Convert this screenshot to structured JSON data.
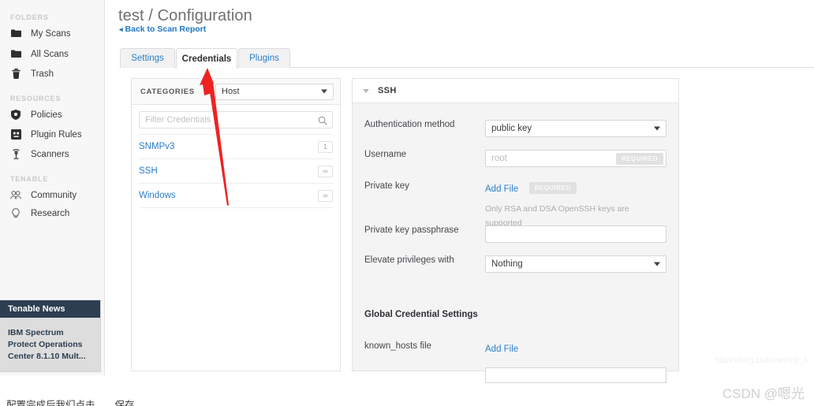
{
  "sidebar": {
    "sections": [
      {
        "label": "FOLDERS"
      },
      {
        "label": "RESOURCES"
      },
      {
        "label": "TENABLE"
      }
    ],
    "folders": [
      {
        "label": "My Scans",
        "icon": "folder-icon"
      },
      {
        "label": "All Scans",
        "icon": "folder-icon"
      },
      {
        "label": "Trash",
        "icon": "trash-icon"
      }
    ],
    "resources": [
      {
        "label": "Policies",
        "icon": "shield-icon"
      },
      {
        "label": "Plugin Rules",
        "icon": "plugin-icon"
      },
      {
        "label": "Scanners",
        "icon": "scanner-icon"
      }
    ],
    "tenable": [
      {
        "label": "Community",
        "icon": "people-icon"
      },
      {
        "label": "Research",
        "icon": "lightbulb-icon"
      }
    ],
    "news": {
      "title": "Tenable News",
      "body": "IBM Spectrum Protect Operations Center 8.1.10 Mult..."
    }
  },
  "header": {
    "title": "test / Configuration",
    "back_link": "Back to Scan Report",
    "back_caret": "◂"
  },
  "tabs": [
    {
      "label": "Settings",
      "active": false
    },
    {
      "label": "Credentials",
      "active": true
    },
    {
      "label": "Plugins",
      "active": false
    }
  ],
  "credentials_panel": {
    "categories_label": "CATEGORIES",
    "category_selected": "Host",
    "filter_placeholder": "Filter Credentials",
    "filter_value": "",
    "rows": [
      {
        "name": "SNMPv3",
        "badge": "1"
      },
      {
        "name": "SSH",
        "badge": "∞"
      },
      {
        "name": "Windows",
        "badge": "∞"
      }
    ]
  },
  "ssh_panel": {
    "title": "SSH",
    "fields": [
      {
        "label": "Authentication method",
        "type": "select",
        "value": "public key"
      },
      {
        "label": "Username",
        "type": "input",
        "value": "",
        "placeholder": "root",
        "required_badge": "REQUIRED"
      },
      {
        "label": "Private key",
        "type": "file",
        "link": "Add File",
        "required_badge": "REQUIRED",
        "hint": "Only RSA and DSA OpenSSH keys are supported"
      },
      {
        "label": "Private key passphrase",
        "type": "input",
        "value": "",
        "placeholder": ""
      },
      {
        "label": "Elevate privileges with",
        "type": "select",
        "value": "Nothing"
      }
    ],
    "global_section": "Global Credential Settings",
    "known_hosts": {
      "label": "known_hosts file",
      "link": "Add File"
    }
  },
  "watermarks": {
    "url": "https://blog.csdn.net/m0_4",
    "csdn": "CSDN @嗯光"
  },
  "bottom_text": "配置完成后我们点击。。。保存",
  "colors": {
    "link": "#2a7fc9",
    "annotation": "#ef2222",
    "news_header": "#2c3e50"
  }
}
